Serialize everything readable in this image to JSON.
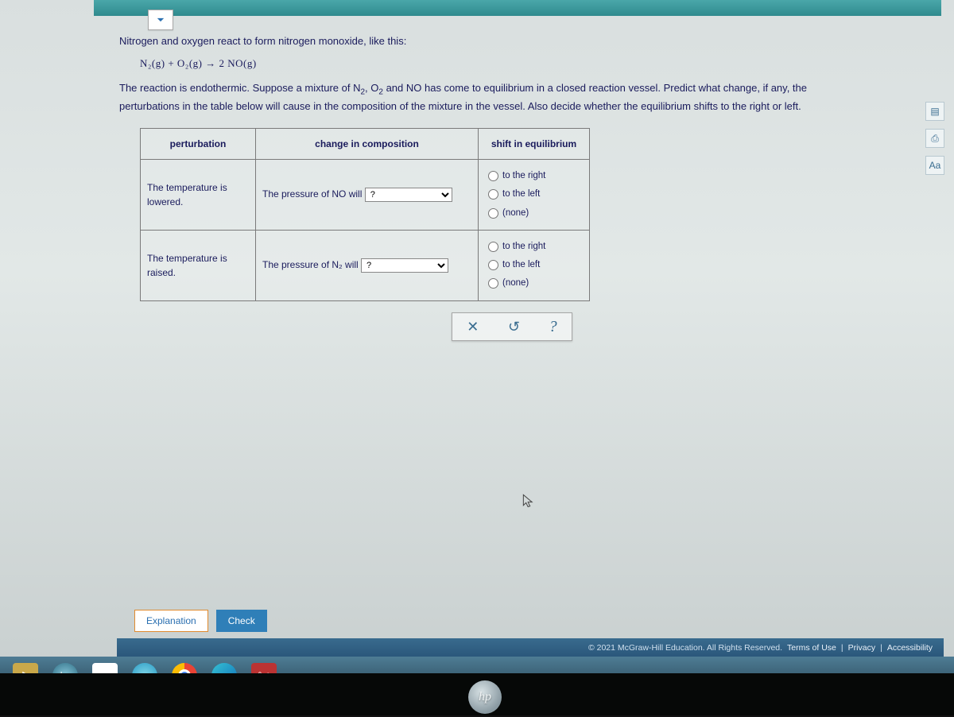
{
  "intro": {
    "line1": "Nitrogen and oxygen react to form nitrogen monoxide, like this:",
    "equation": "N₂(g) + O₂(g) → 2 NO(g)",
    "line2a": "The reaction is endothermic. Suppose a mixture of N",
    "line2b": ", O",
    "line2c": " and NO has come to equilibrium in a closed reaction vessel. Predict what change, if any, the",
    "line3": "perturbations in the table below will cause in the composition of the mixture in the vessel. Also decide whether the equilibrium shifts to the right or left."
  },
  "table": {
    "headers": {
      "h1": "perturbation",
      "h2": "change in composition",
      "h3": "shift in equilibrium"
    },
    "rows": [
      {
        "perturb_l1": "The temperature is",
        "perturb_l2": "lowered.",
        "change_prefix": "The pressure of NO will",
        "select_value": "?",
        "opts": {
          "right": "to the right",
          "left": "to the left",
          "none": "(none)"
        }
      },
      {
        "perturb_l1": "The temperature is raised.",
        "perturb_l2": "",
        "change_prefix": "The pressure of N₂ will",
        "select_value": "?",
        "opts": {
          "right": "to the right",
          "left": "to the left",
          "none": "(none)"
        }
      }
    ]
  },
  "controls": {
    "clear": "✕",
    "reset": "↺",
    "help": "?"
  },
  "buttons": {
    "explanation": "Explanation",
    "check": "Check"
  },
  "footer": {
    "copyright": "© 2021 McGraw-Hill Education. All Rights Reserved.",
    "terms": "Terms of Use",
    "privacy": "Privacy",
    "access": "Accessibility"
  },
  "side": {
    "a": "▤",
    "b": "⎙",
    "c": "Aa"
  },
  "hp": "hp"
}
